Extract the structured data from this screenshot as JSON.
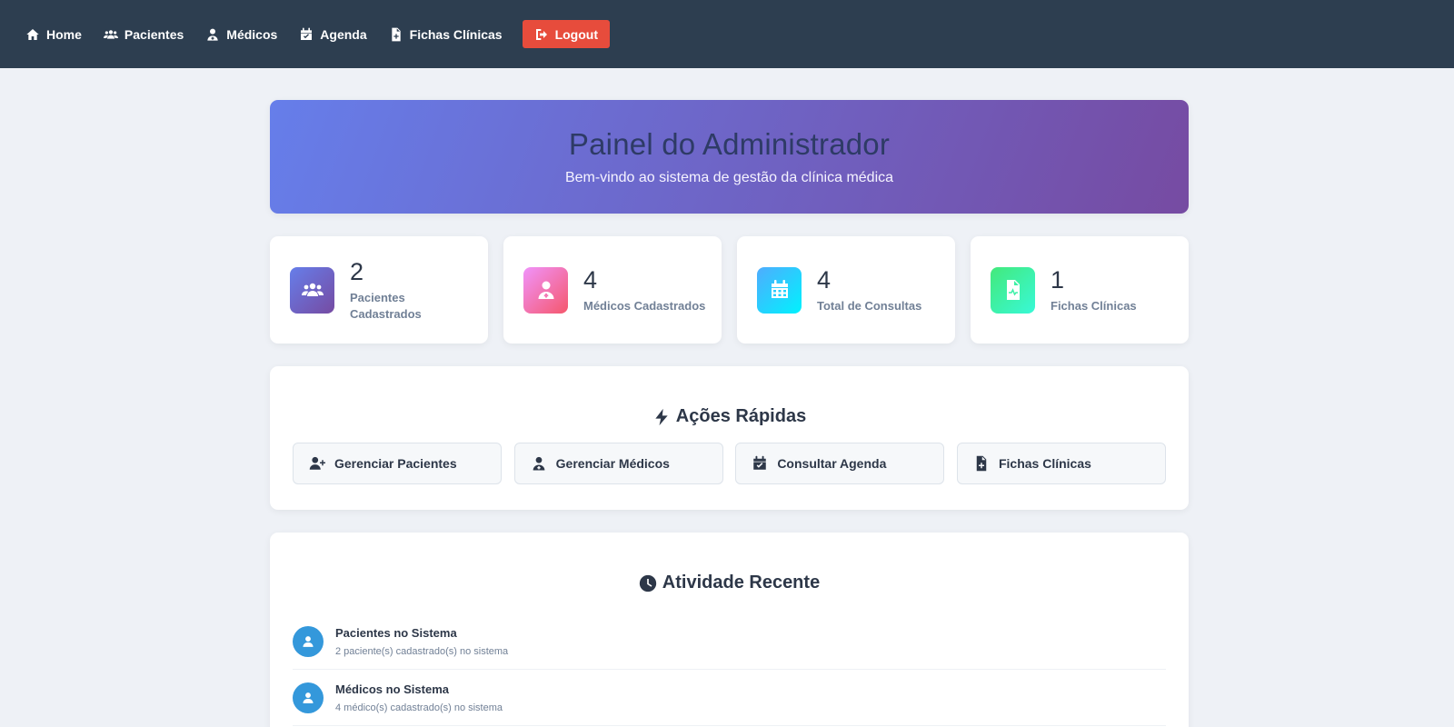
{
  "nav": {
    "items": [
      {
        "label": "Home",
        "icon": "home-icon"
      },
      {
        "label": "Pacientes",
        "icon": "users-icon"
      },
      {
        "label": "Médicos",
        "icon": "doctor-icon"
      },
      {
        "label": "Agenda",
        "icon": "calendar-check-icon"
      },
      {
        "label": "Fichas Clínicas",
        "icon": "file-medical-icon"
      }
    ],
    "logout_label": "Logout",
    "logout_icon": "sign-out-icon",
    "colors": {
      "navbar": "#2d3e50",
      "logout": "#e74c3c"
    }
  },
  "hero": {
    "title": "Painel do Administrador",
    "subtitle": "Bem-vindo ao sistema de gestão da clínica médica",
    "gradient": [
      "#667eea",
      "#764ba2"
    ]
  },
  "stats": [
    {
      "value": "2",
      "label": "Pacientes Cadastrados",
      "icon": "users-icon",
      "gradient": [
        "#667eea",
        "#764ba2"
      ]
    },
    {
      "value": "4",
      "label": "Médicos Cadastrados",
      "icon": "doctor-icon",
      "gradient": [
        "#f093fb",
        "#f5576c"
      ]
    },
    {
      "value": "4",
      "label": "Total de Consultas",
      "icon": "calendar-icon",
      "gradient": [
        "#4facfe",
        "#00f2fe"
      ]
    },
    {
      "value": "1",
      "label": "Fichas Clínicas",
      "icon": "file-medical-icon",
      "gradient": [
        "#43e97b",
        "#38f9d7"
      ]
    }
  ],
  "quick_actions": {
    "title": "Ações Rápidas",
    "icon": "bolt-icon",
    "items": [
      {
        "label": "Gerenciar Pacientes",
        "icon": "user-plus-icon"
      },
      {
        "label": "Gerenciar Médicos",
        "icon": "doctor-icon"
      },
      {
        "label": "Consultar Agenda",
        "icon": "calendar-check-icon"
      },
      {
        "label": "Fichas Clínicas",
        "icon": "file-medical-icon"
      }
    ]
  },
  "recent_activity": {
    "title": "Atividade Recente",
    "icon": "clock-icon",
    "items": [
      {
        "title": "Pacientes no Sistema",
        "description": "2 paciente(s) cadastrado(s) no sistema",
        "icon": "user-icon"
      },
      {
        "title": "Médicos no Sistema",
        "description": "4 médico(s) cadastrado(s) no sistema",
        "icon": "user-icon"
      }
    ]
  }
}
